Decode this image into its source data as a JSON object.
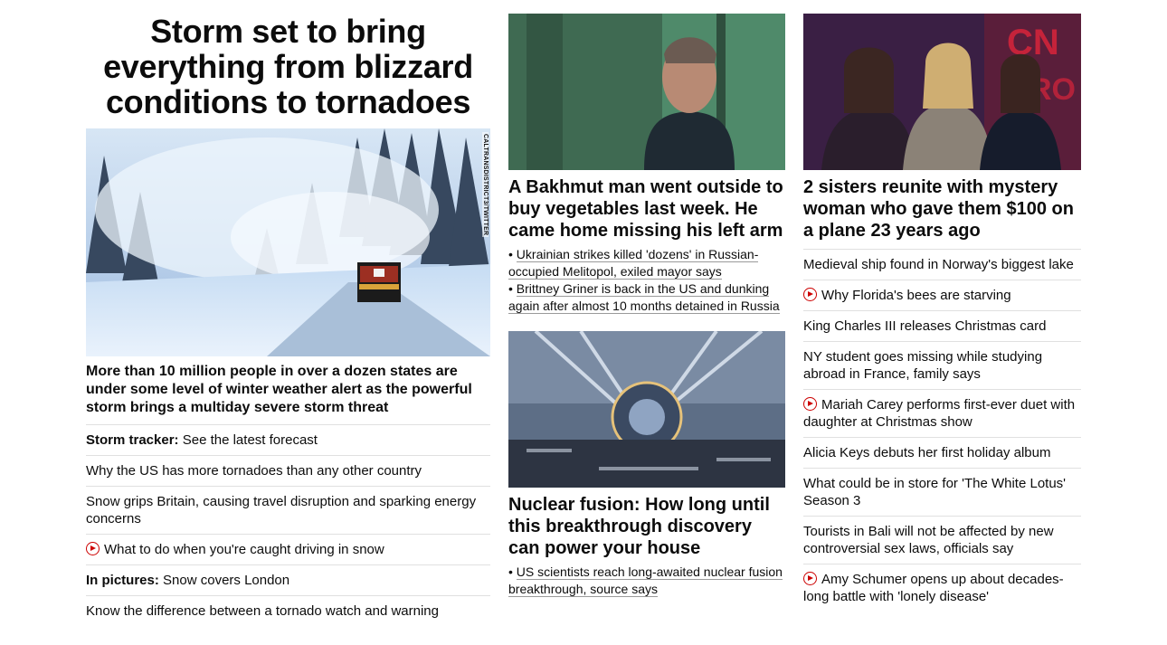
{
  "left": {
    "headline": "Storm set to bring everything from blizzard conditions to tornadoes",
    "image_alt": "Snow blower clearing a snowy mountain road",
    "image_credit": "CALTRANSDISTRICT3/TWITTER",
    "lede": "More than 10 million people in over a dozen states are under some level of winter weather alert as the powerful storm brings a multiday severe storm threat",
    "links": [
      {
        "prefix": "Storm tracker:",
        "text": "See the latest forecast",
        "video": false
      },
      {
        "prefix": "",
        "text": "Why the US has more tornadoes than any other country",
        "video": false
      },
      {
        "prefix": "",
        "text": "Snow grips Britain, causing travel disruption and sparking energy concerns",
        "video": false
      },
      {
        "prefix": "",
        "text": "What to do when you're caught driving in snow",
        "video": true
      },
      {
        "prefix": "In pictures:",
        "text": "Snow covers London",
        "video": false
      },
      {
        "prefix": "",
        "text": "Know the difference between a tornado watch and warning",
        "video": false
      }
    ]
  },
  "middle": {
    "card1": {
      "headline": "A Bakhmut man went outside to buy vegetables last week. He came home missing his left arm",
      "sublinks": [
        "Ukrainian strikes killed 'dozens' in Russian-occupied Melitopol, exiled mayor says",
        "Brittney Griner is back in the US and dunking again after almost 10 months detained in Russia"
      ]
    },
    "card2": {
      "headline": "Nuclear fusion: How long until this breakthrough discovery can power your house",
      "sublinks": [
        "US scientists reach long-awaited nuclear fusion breakthrough, source says"
      ]
    }
  },
  "right": {
    "headline": "2 sisters reunite with mystery woman who gave them $100 on a plane 23 years ago",
    "links": [
      {
        "text": "Medieval ship found in Norway's biggest lake",
        "video": false
      },
      {
        "text": "Why Florida's bees are starving",
        "video": true
      },
      {
        "text": "King Charles III releases Christmas card",
        "video": false
      },
      {
        "text": "NY student goes missing while studying abroad in France, family says",
        "video": false
      },
      {
        "text": "Mariah Carey performs first-ever duet with daughter at Christmas show",
        "video": true
      },
      {
        "text": "Alicia Keys debuts her first holiday album",
        "video": false
      },
      {
        "text": "What could be in store for 'The White Lotus' Season 3",
        "video": false
      },
      {
        "text": "Tourists in Bali will not be affected by new controversial sex laws, officials say",
        "video": false
      },
      {
        "text": "Amy Schumer opens up about decades-long battle with 'lonely disease'",
        "video": true
      }
    ]
  },
  "colors": {
    "video_icon": "#cc0000",
    "divider": "#e0e0e0",
    "text": "#0c0c0c"
  }
}
